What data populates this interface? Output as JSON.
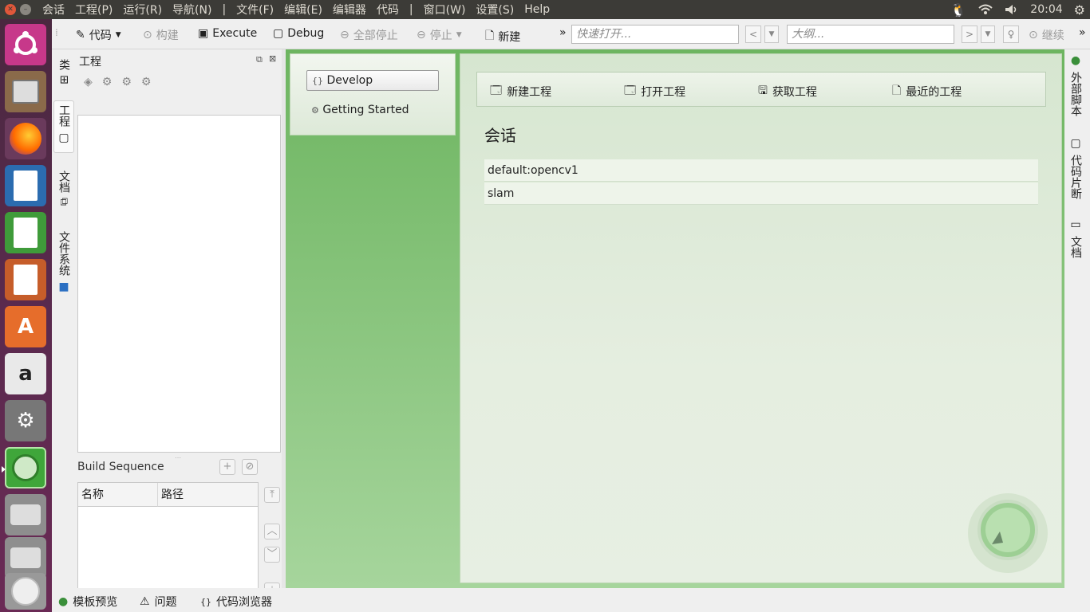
{
  "topbar": {
    "menus": [
      "会话",
      "工程(P)",
      "运行(R)",
      "导航(N)",
      "|",
      "文件(F)",
      "编辑(E)",
      "编辑器",
      "代码",
      "|",
      "窗口(W)",
      "设置(S)",
      "Help"
    ],
    "clock": "20:04"
  },
  "toolbar": {
    "code": "代码",
    "build": "构建",
    "execute": "Execute",
    "debug": "Debug",
    "stop_all": "全部停止",
    "stop": "停止",
    "new": "新建",
    "quick_open_placeholder": "快速打开...",
    "outline_placeholder": "大纲...",
    "continue": "继续"
  },
  "left_tabs": [
    "类",
    "工程",
    "文档",
    "文件系统"
  ],
  "project_panel": {
    "title": "工程",
    "build_sequence": "Build Sequence",
    "columns": [
      "名称",
      "路径"
    ]
  },
  "welcome": {
    "side_items": [
      "Develop",
      "Getting Started"
    ],
    "actions": [
      "新建工程",
      "打开工程",
      "获取工程",
      "最近的工程"
    ],
    "sessions_title": "会话",
    "sessions": [
      "default:opencv1",
      "slam"
    ]
  },
  "right_tabs": [
    "外部脚本",
    "代码片断",
    "文档"
  ],
  "bottom_bar": [
    "模板预览",
    "问题",
    "代码浏览器"
  ],
  "colors": {
    "panel_bg": "#3c3b37",
    "welcome_green": "#6db560",
    "launcher": "#5a2a4e"
  }
}
